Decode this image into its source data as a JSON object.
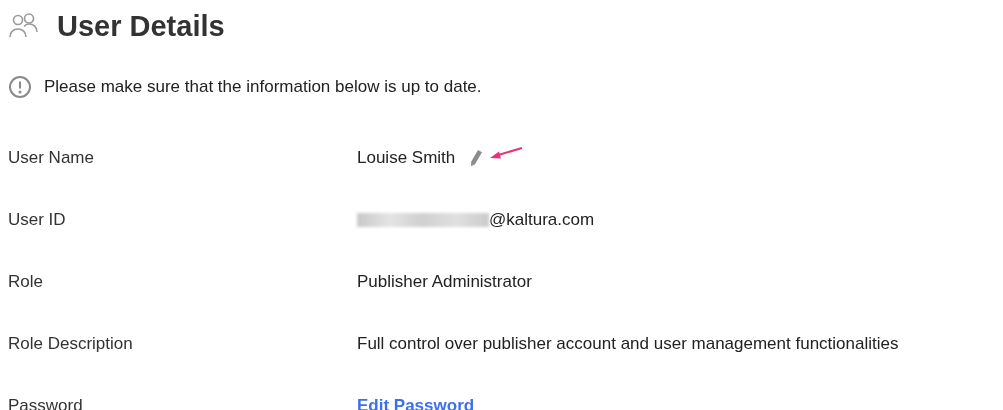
{
  "header": {
    "title": "User Details"
  },
  "notice": {
    "text": "Please make sure that the information below is up to date."
  },
  "fields": [
    {
      "label": "User Name",
      "kind": "editable",
      "value": "Louise Smith"
    },
    {
      "label": "User ID",
      "kind": "masked",
      "value": "@kaltura.com"
    },
    {
      "label": "Role",
      "kind": "text",
      "value": "Publisher Administrator"
    },
    {
      "label": "Role Description",
      "kind": "text",
      "value": "Full control over publisher account and user management functionalities"
    },
    {
      "label": "Password",
      "kind": "link",
      "value": "Edit Password"
    }
  ]
}
